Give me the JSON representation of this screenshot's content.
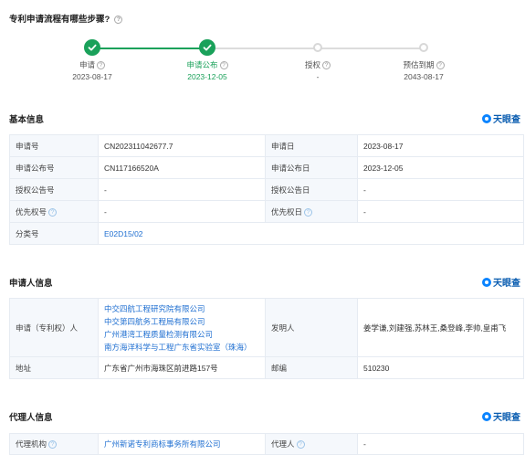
{
  "question": "专利申请流程有哪些步骤?",
  "steps": [
    {
      "label": "申请",
      "date": "2023-08-17",
      "state": "done"
    },
    {
      "label": "申请公布",
      "date": "2023-12-05",
      "state": "done"
    },
    {
      "label": "授权",
      "date": "-",
      "state": "pending"
    },
    {
      "label": "预估到期",
      "date": "2043-08-17",
      "state": "pending"
    }
  ],
  "brand": "天眼查",
  "basic": {
    "title": "基本信息",
    "app_no_label": "申请号",
    "app_no": "CN202311042677.7",
    "app_date_label": "申请日",
    "app_date": "2023-08-17",
    "pub_no_label": "申请公布号",
    "pub_no": "CN117166520A",
    "pub_date_label": "申请公布日",
    "pub_date": "2023-12-05",
    "grant_no_label": "授权公告号",
    "grant_no": "-",
    "grant_date_label": "授权公告日",
    "grant_date": "-",
    "priority_no_label": "优先权号",
    "priority_no": "-",
    "priority_date_label": "优先权日",
    "priority_date": "-",
    "class_label": "分类号",
    "class_value": "E02D15/02"
  },
  "applicant": {
    "title": "申请人信息",
    "holder_label": "申请（专利权）人",
    "holders": [
      "中交四航工程研究院有限公司",
      "中交第四航务工程局有限公司",
      "广州港湾工程质量检测有限公司",
      "南方海洋科学与工程广东省实验室（珠海）"
    ],
    "inventor_label": "发明人",
    "inventors": "姜学谦,刘建强,苏林王,桑登峰,李帅,皇甫飞",
    "address_label": "地址",
    "address": "广东省广州市海珠区前进路157号",
    "zip_label": "邮编",
    "zip": "510230"
  },
  "agent": {
    "title": "代理人信息",
    "org_label": "代理机构",
    "org": "广州新诺专利商标事务所有限公司",
    "person_label": "代理人",
    "person": "-"
  }
}
